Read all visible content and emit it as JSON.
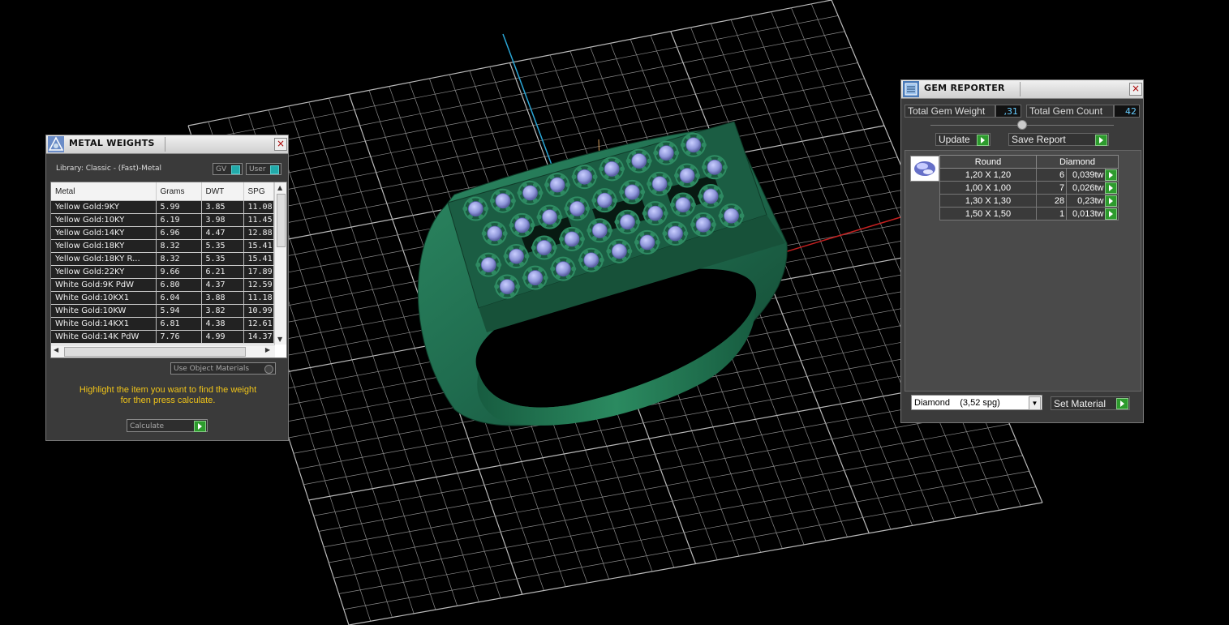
{
  "metal_weights": {
    "title": "METAL WEIGHTS",
    "library": "Library: Classic - (Fast)-Metal",
    "toggle_gv": "GV",
    "toggle_user": "User",
    "columns": [
      "Metal",
      "Grams",
      "DWT",
      "SPG"
    ],
    "rows": [
      [
        "Yellow Gold:9KY",
        "5.99",
        "3.85",
        "11.08"
      ],
      [
        "Yellow Gold:10KY",
        "6.19",
        "3.98",
        "11.45"
      ],
      [
        "Yellow Gold:14KY",
        "6.96",
        "4.47",
        "12.88"
      ],
      [
        "Yellow Gold:18KY",
        "8.32",
        "5.35",
        "15.41"
      ],
      [
        "Yellow Gold:18KY R...",
        "8.32",
        "5.35",
        "15.41"
      ],
      [
        "Yellow Gold:22KY",
        "9.66",
        "6.21",
        "17.89"
      ],
      [
        "White Gold:9K PdW",
        "6.80",
        "4.37",
        "12.59"
      ],
      [
        "White Gold:10KX1",
        "6.04",
        "3.88",
        "11.18"
      ],
      [
        "White Gold:10KW",
        "5.94",
        "3.82",
        "10.99"
      ],
      [
        "White Gold:14KX1",
        "6.81",
        "4.38",
        "12.61"
      ],
      [
        "White Gold:14K PdW",
        "7.76",
        "4.99",
        "14.37"
      ]
    ],
    "use_object_materials": "Use Object Materials",
    "hint_line1": "Highlight the item you want to find the weight",
    "hint_line2": "for then press calculate.",
    "calculate": "Calculate"
  },
  "gem_reporter": {
    "title": "GEM REPORTER",
    "total_weight_label": "Total Gem Weight",
    "total_weight_value": ",31",
    "total_count_label": "Total Gem Count",
    "total_count_value": "42",
    "update": "Update",
    "save_report": "Save Report",
    "header_shape": "Round",
    "header_material": "Diamond",
    "rows": [
      {
        "size": "1,20 X 1,20",
        "count": "6",
        "weight": "0,039tw"
      },
      {
        "size": "1,00 X 1,00",
        "count": "7",
        "weight": "0,026tw"
      },
      {
        "size": "1,30 X 1,30",
        "count": "28",
        "weight": "0,23tw"
      },
      {
        "size": "1,50 X 1,50",
        "count": "1",
        "weight": "0,013tw"
      }
    ],
    "material_select": "Diamond    (3,52 spg)",
    "set_material": "Set Material"
  },
  "colors": {
    "ring": "#1f6b4e",
    "gems": "#8d95d8",
    "grid": "#9a9a9a",
    "axis_y": "#2aa6d6",
    "axis_x": "#c42020",
    "hint": "#f0c419",
    "go_button": "#2d9b2d"
  }
}
